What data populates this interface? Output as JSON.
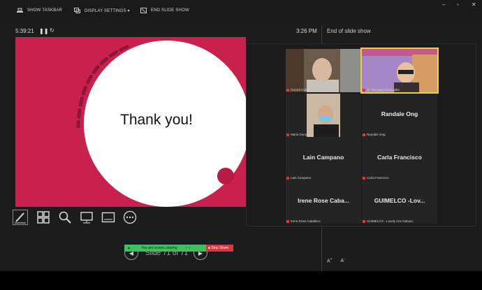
{
  "toolbar": {
    "show_taskbar": "SHOW TASKBAR",
    "display_settings": "DISPLAY SETTINGS ▾",
    "end_slide_show": "END SLIDE SHOW"
  },
  "window_controls": [
    "–",
    "▫",
    "✕"
  ],
  "presenter": {
    "timer": "5:39:21",
    "clock": "3:26 PM",
    "next_label": "End of slide show",
    "slide_counter": "Slide 71 of 71"
  },
  "slide": {
    "text": "Thank you!",
    "bg_color": "#c9214e"
  },
  "share_bar": {
    "sharing_text": "You are screen sharing",
    "stop_text": "Stop Share"
  },
  "font_buttons": [
    "A",
    "A"
  ],
  "participants": [
    {
      "name": "",
      "tag": "Gerard Hubal",
      "video": true
    },
    {
      "name": "",
      "tag": "Dr. Mozaida Barangalla",
      "video": true,
      "active": true
    },
    {
      "name": "",
      "tag": "Maria Dumopt",
      "video": true
    },
    {
      "name": "Randale Ong",
      "tag": "Randale Ong",
      "video": false
    },
    {
      "name": "Lain Campano",
      "tag": "Lain Campano",
      "video": false
    },
    {
      "name": "Carla Francisco",
      "tag": "Carla Francisco",
      "video": false
    },
    {
      "name": "Irene Rose Caba...",
      "tag": "Irene Rose Caballero",
      "video": false
    },
    {
      "name": "GUIMELCO -Lov...",
      "tag": "GUIMELCO - Lovely Ann Gatuen",
      "video": false
    }
  ]
}
